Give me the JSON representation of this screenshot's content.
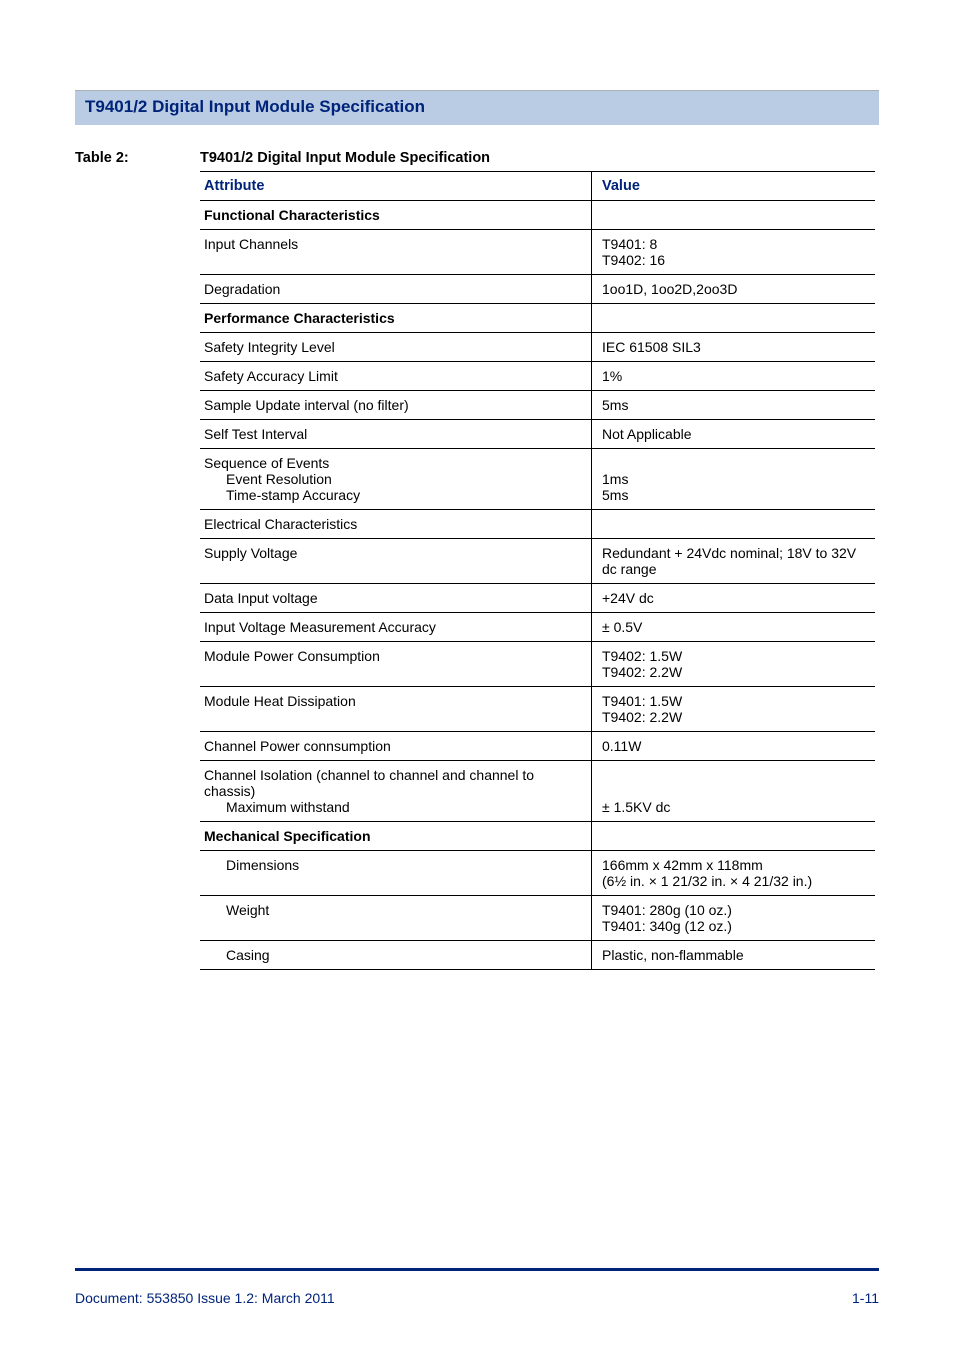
{
  "band_title": "T9401/2 Digital Input Module Specification",
  "table_label": "Table 2:",
  "table_caption": "T9401/2 Digital Input Module Specification",
  "headers": {
    "attribute": "Attribute",
    "value": "Value"
  },
  "rows": {
    "func_char": "Functional Characteristics",
    "input_channels": {
      "attr": "Input Channels",
      "val1": "T9401: 8",
      "val2": "T9402: 16"
    },
    "degradation": {
      "attr": "Degradation",
      "val": "1oo1D, 1oo2D,2oo3D"
    },
    "perf_char": "Performance Characteristics",
    "sil": {
      "attr": "Safety Integrity Level",
      "val": "IEC 61508 SIL3"
    },
    "sal": {
      "attr": "Safety Accuracy Limit",
      "val": "1%"
    },
    "sui": {
      "attr": "Sample Update interval (no filter)",
      "val": "5ms"
    },
    "sti": {
      "attr": "Self Test Interval",
      "val": "Not Applicable"
    },
    "seq": {
      "attr": "Sequence of Events",
      "sub1_attr": "Event Resolution",
      "sub1_val": "1ms",
      "sub2_attr": "Time-stamp Accuracy",
      "sub2_val": "5ms"
    },
    "elec": "Electrical Characteristics",
    "supply": {
      "attr": "Supply Voltage",
      "val": "Redundant + 24Vdc nominal; 18V to 32V dc range"
    },
    "div": {
      "attr": "Data Input voltage",
      "val": "+24V dc"
    },
    "ivma": {
      "attr": "Input Voltage Measurement Accuracy",
      "val": "± 0.5V"
    },
    "mpc": {
      "attr": "Module Power Consumption",
      "val1": "T9402: 1.5W",
      "val2": "T9402: 2.2W"
    },
    "mhd": {
      "attr": "Module Heat Dissipation",
      "val1": "T9401: 1.5W",
      "val2": "T9402: 2.2W"
    },
    "cpc": {
      "attr": "Channel Power connsumption",
      "val": "0.11W"
    },
    "iso": {
      "attr": "Channel Isolation (channel to channel and channel to chassis)",
      "sub_attr": "Maximum withstand",
      "sub_val": "± 1.5KV dc"
    },
    "mech": "Mechanical Specification",
    "dim": {
      "attr": "Dimensions",
      "val1": "166mm x 42mm x 118mm",
      "val2": "(6½ in. × 1 21/32 in. × 4 21/32 in.)"
    },
    "weight": {
      "attr": "Weight",
      "val1": "T9401: 280g (10 oz.)",
      "val2": "T9401: 340g (12 oz.)"
    },
    "casing": {
      "attr": "Casing",
      "val": "Plastic, non-flammable"
    }
  },
  "footer": {
    "doc": "Document: 553850 Issue 1.2: March 2011",
    "page": "1-11"
  }
}
